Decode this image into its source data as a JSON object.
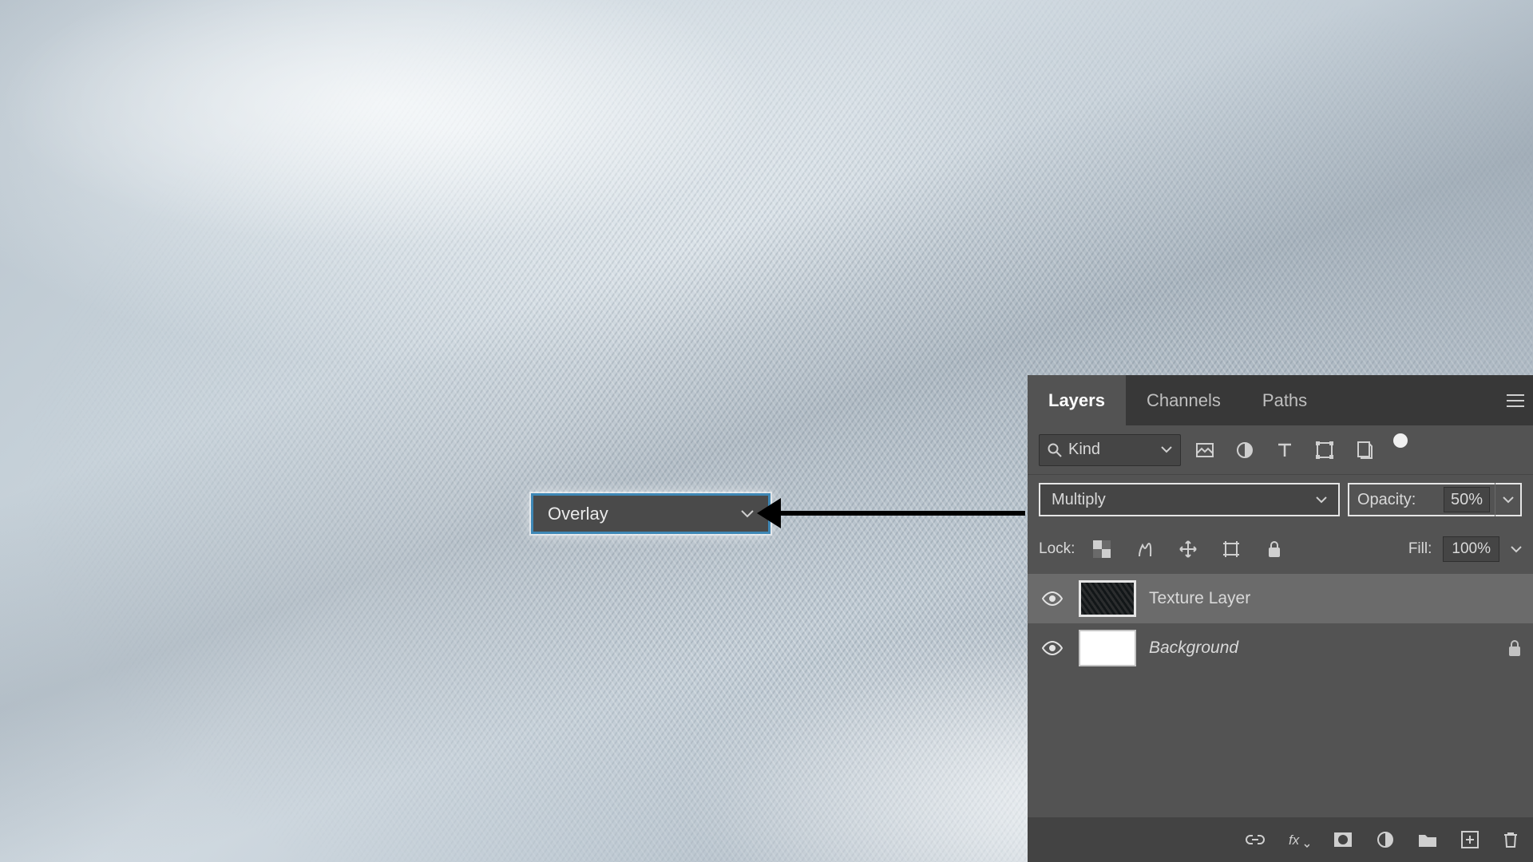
{
  "annotation": {
    "overlay_value": "Overlay"
  },
  "panel": {
    "tabs": {
      "layers": "Layers",
      "channels": "Channels",
      "paths": "Paths"
    },
    "filter": {
      "kind_label": "Kind"
    },
    "blend": {
      "mode_value": "Multiply",
      "opacity_label": "Opacity:",
      "opacity_value": "50%"
    },
    "lock": {
      "label": "Lock:",
      "fill_label": "Fill:",
      "fill_value": "100%"
    },
    "layers": {
      "texture": "Texture Layer",
      "background": "Background"
    }
  }
}
